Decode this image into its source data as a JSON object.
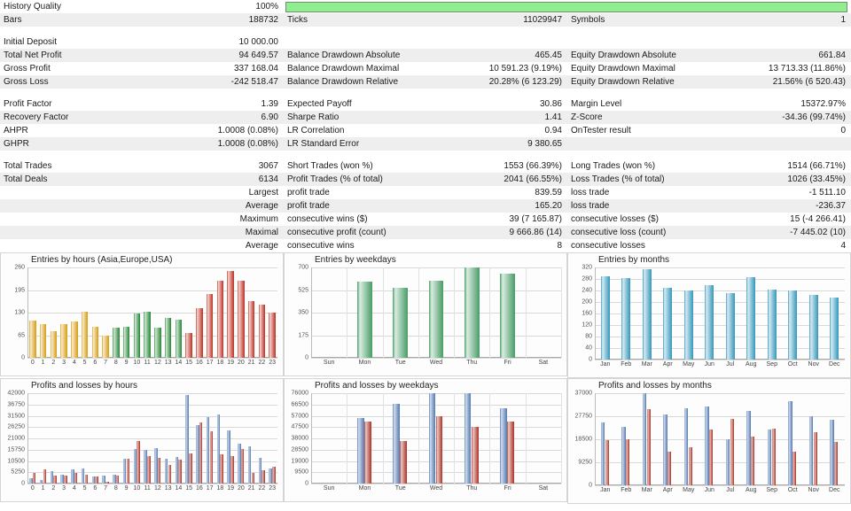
{
  "header": {
    "history_quality_label": "History Quality",
    "history_quality_value": "100%",
    "progress_percent": 100,
    "progress_color": "#90ee90"
  },
  "stats": {
    "rows": [
      {
        "c1": {
          "label": "History Quality",
          "value": "100%"
        },
        "c2": {
          "type": "progress"
        },
        "alt": false
      },
      {
        "c1": {
          "label": "Bars",
          "value": "188732"
        },
        "c2": {
          "label": "Ticks",
          "value": "11029947"
        },
        "c3": {
          "label": "Symbols",
          "value": "1"
        },
        "alt": true
      },
      {
        "c1": {
          "label": "Initial Deposit",
          "value": "10 000.00"
        },
        "c2": {
          "label": "",
          "value": ""
        },
        "c3": {
          "label": "",
          "value": ""
        },
        "alt": false
      },
      {
        "c1": {
          "label": "Total Net Profit",
          "value": "94 649.57"
        },
        "c2": {
          "label": "Balance Drawdown Absolute",
          "value": "465.45"
        },
        "c3": {
          "label": "Equity Drawdown Absolute",
          "value": "661.84"
        },
        "alt": true
      },
      {
        "c1": {
          "label": "Gross Profit",
          "value": "337 168.04"
        },
        "c2": {
          "label": "Balance Drawdown Maximal",
          "value": "10 591.23 (9.19%)"
        },
        "c3": {
          "label": "Equity Drawdown Maximal",
          "value": "13 713.33 (11.86%)"
        },
        "alt": false
      },
      {
        "c1": {
          "label": "Gross Loss",
          "value": "-242 518.47"
        },
        "c2": {
          "label": "Balance Drawdown Relative",
          "value": "20.28% (6 123.29)"
        },
        "c3": {
          "label": "Equity Drawdown Relative",
          "value": "21.56% (6 520.43)"
        },
        "alt": true
      },
      {
        "c1": {
          "label": "Profit Factor",
          "value": "1.39"
        },
        "c2": {
          "label": "Expected Payoff",
          "value": "30.86"
        },
        "c3": {
          "label": "Margin Level",
          "value": "15372.97%"
        },
        "alt": false
      },
      {
        "c1": {
          "label": "Recovery Factor",
          "value": "6.90"
        },
        "c2": {
          "label": "Sharpe Ratio",
          "value": "1.41"
        },
        "c3": {
          "label": "Z-Score",
          "value": "-34.36 (99.74%)"
        },
        "alt": true
      },
      {
        "c1": {
          "label": "AHPR",
          "value": "1.0008 (0.08%)"
        },
        "c2": {
          "label": "LR Correlation",
          "value": "0.94"
        },
        "c3": {
          "label": "OnTester result",
          "value": "0"
        },
        "alt": false
      },
      {
        "c1": {
          "label": "GHPR",
          "value": "1.0008 (0.08%)"
        },
        "c2": {
          "label": "LR Standard Error",
          "value": "9 380.65"
        },
        "c3": {
          "label": "",
          "value": ""
        },
        "alt": true
      },
      {
        "c1": {
          "label": "Total Trades",
          "value": "3067"
        },
        "c2": {
          "label": "Short Trades (won %)",
          "value": "1553 (66.39%)"
        },
        "c3": {
          "label": "Long Trades (won %)",
          "value": "1514 (66.71%)"
        },
        "alt": false
      },
      {
        "c1": {
          "label": "Total Deals",
          "value": "6134"
        },
        "c2": {
          "label": "Profit Trades (% of total)",
          "value": "2041 (66.55%)"
        },
        "c3": {
          "label": "Loss Trades (% of total)",
          "value": "1026 (33.45%)"
        },
        "alt": true
      },
      {
        "c1": {
          "label": "",
          "value": "Largest"
        },
        "c2": {
          "label": "profit trade",
          "value": "839.59"
        },
        "c3": {
          "label": "loss trade",
          "value": "-1 511.10"
        },
        "alt": false
      },
      {
        "c1": {
          "label": "",
          "value": "Average"
        },
        "c2": {
          "label": "profit trade",
          "value": "165.20"
        },
        "c3": {
          "label": "loss trade",
          "value": "-236.37"
        },
        "alt": true
      },
      {
        "c1": {
          "label": "",
          "value": "Maximum"
        },
        "c2": {
          "label": "consecutive wins ($)",
          "value": "39 (7 165.87)"
        },
        "c3": {
          "label": "consecutive losses ($)",
          "value": "15 (-4 266.41)"
        },
        "alt": false
      },
      {
        "c1": {
          "label": "",
          "value": "Maximal"
        },
        "c2": {
          "label": "consecutive profit (count)",
          "value": "9 666.86 (14)"
        },
        "c3": {
          "label": "consecutive loss (count)",
          "value": "-7 445.02 (10)"
        },
        "alt": true
      },
      {
        "c1": {
          "label": "",
          "value": "Average"
        },
        "c2": {
          "label": "consecutive wins",
          "value": "8"
        },
        "c3": {
          "label": "consecutive losses",
          "value": "4"
        },
        "alt": false
      }
    ]
  },
  "chart_data": [
    {
      "id": "entries-by-hours",
      "type": "bar",
      "title": "Entries by hours (Asia,Europe,USA)",
      "xlabel": "",
      "ylabel": "",
      "ylim": [
        0,
        260
      ],
      "yticks": [
        0,
        65,
        130,
        195,
        260
      ],
      "grid": true,
      "categories": [
        "0",
        "1",
        "2",
        "3",
        "4",
        "5",
        "6",
        "7",
        "8",
        "9",
        "10",
        "11",
        "12",
        "13",
        "14",
        "15",
        "16",
        "17",
        "18",
        "19",
        "20",
        "21",
        "22",
        "23"
      ],
      "values": [
        108,
        97,
        77,
        98,
        105,
        133,
        88,
        65,
        87,
        90,
        127,
        133,
        86,
        114,
        109,
        71,
        143,
        183,
        222,
        250,
        222,
        163,
        153,
        131
      ],
      "segment_colors": [
        "#d8a01a",
        "#d8a01a",
        "#d8a01a",
        "#d8a01a",
        "#d8a01a",
        "#d8a01a",
        "#d8a01a",
        "#d8a01a",
        "#2e8b3e",
        "#2e8b3e",
        "#2e8b3e",
        "#2e8b3e",
        "#2e8b3e",
        "#2e8b3e",
        "#2e8b3e",
        "#c0392b",
        "#c0392b",
        "#c0392b",
        "#c0392b",
        "#c0392b",
        "#c0392b",
        "#c0392b",
        "#c0392b",
        "#c0392b"
      ],
      "legend": [
        "Asia",
        "Europe",
        "USA"
      ]
    },
    {
      "id": "entries-by-weekdays",
      "type": "bar",
      "title": "Entries by weekdays",
      "xlabel": "",
      "ylabel": "",
      "ylim": [
        0,
        700
      ],
      "yticks": [
        0,
        175,
        350,
        525,
        700
      ],
      "grid": true,
      "categories": [
        "Sun",
        "Mon",
        "Tue",
        "Wed",
        "Thu",
        "Fri",
        "Sat"
      ],
      "values": [
        0,
        590,
        545,
        600,
        700,
        650,
        0
      ],
      "color": "#4fa06c"
    },
    {
      "id": "entries-by-months",
      "type": "bar",
      "title": "Entries by months",
      "xlabel": "",
      "ylabel": "",
      "ylim": [
        0,
        320
      ],
      "yticks": [
        0,
        40,
        80,
        120,
        160,
        200,
        240,
        280,
        320
      ],
      "grid": true,
      "categories": [
        "Jan",
        "Feb",
        "Mar",
        "Apr",
        "May",
        "Jun",
        "Jul",
        "Aug",
        "Sep",
        "Oct",
        "Nov",
        "Dec"
      ],
      "values": [
        290,
        283,
        313,
        249,
        240,
        258,
        232,
        285,
        242,
        240,
        226,
        216
      ],
      "color": "#3d9bbd"
    },
    {
      "id": "profits-losses-by-hours",
      "type": "bar",
      "title": "Profits and losses by hours",
      "xlabel": "",
      "ylabel": "",
      "ylim": [
        0,
        42000
      ],
      "yticks": [
        0,
        5250,
        10500,
        15750,
        21000,
        26250,
        31500,
        36750,
        42000
      ],
      "grid": true,
      "categories": [
        "0",
        "1",
        "2",
        "3",
        "4",
        "5",
        "6",
        "7",
        "8",
        "9",
        "10",
        "11",
        "12",
        "13",
        "14",
        "15",
        "16",
        "17",
        "18",
        "19",
        "20",
        "21",
        "22",
        "23"
      ],
      "series": [
        {
          "name": "Profits",
          "color": "#5b7fb5",
          "values": [
            2600,
            1700,
            5600,
            4000,
            6500,
            7100,
            3400,
            3800,
            4000,
            11500,
            16000,
            15800,
            16400,
            11500,
            12300,
            41000,
            27200,
            30800,
            32000,
            24800,
            18700,
            17500,
            12100,
            6900
          ]
        },
        {
          "name": "Losses",
          "color": "#b03a2e",
          "values": [
            5100,
            6500,
            3600,
            3700,
            5000,
            4000,
            3200,
            800,
            3900,
            11500,
            19900,
            12600,
            11800,
            8800,
            11200,
            14000,
            28500,
            24500,
            13700,
            12600,
            16000,
            5100,
            6200,
            7800
          ]
        }
      ]
    },
    {
      "id": "profits-losses-by-weekdays",
      "type": "bar",
      "title": "Profits and losses by weekdays",
      "xlabel": "",
      "ylabel": "",
      "ylim": [
        0,
        76000
      ],
      "yticks": [
        0,
        9500,
        19000,
        28500,
        38000,
        47500,
        57000,
        66500,
        76000
      ],
      "grid": true,
      "categories": [
        "Sun",
        "Mon",
        "Tue",
        "Wed",
        "Thu",
        "Fri",
        "Sat"
      ],
      "series": [
        {
          "name": "Profits",
          "color": "#5b7fb5",
          "values": [
            0,
            55500,
            67000,
            76000,
            76000,
            63500,
            0
          ]
        },
        {
          "name": "Losses",
          "color": "#b03a2e",
          "values": [
            0,
            52500,
            35500,
            56500,
            47500,
            52000,
            0
          ]
        }
      ]
    },
    {
      "id": "profits-losses-by-months",
      "type": "bar",
      "title": "Profits and losses by months",
      "xlabel": "",
      "ylabel": "",
      "ylim": [
        0,
        37000
      ],
      "yticks": [
        0,
        9250,
        18500,
        27750,
        37000
      ],
      "grid": true,
      "categories": [
        "Jan",
        "Feb",
        "Mar",
        "Apr",
        "May",
        "Jun",
        "Jul",
        "Aug",
        "Sep",
        "Oct",
        "Nov",
        "Dec"
      ],
      "series": [
        {
          "name": "Profits",
          "color": "#5b7fb5",
          "values": [
            25300,
            23600,
            37000,
            28600,
            31000,
            31500,
            18600,
            29800,
            22400,
            33800,
            27800,
            26300
          ]
        },
        {
          "name": "Losses",
          "color": "#b03a2e",
          "values": [
            18200,
            18500,
            30600,
            13500,
            15300,
            22400,
            26600,
            19400,
            22600,
            13500,
            21300,
            17400
          ]
        }
      ]
    }
  ]
}
